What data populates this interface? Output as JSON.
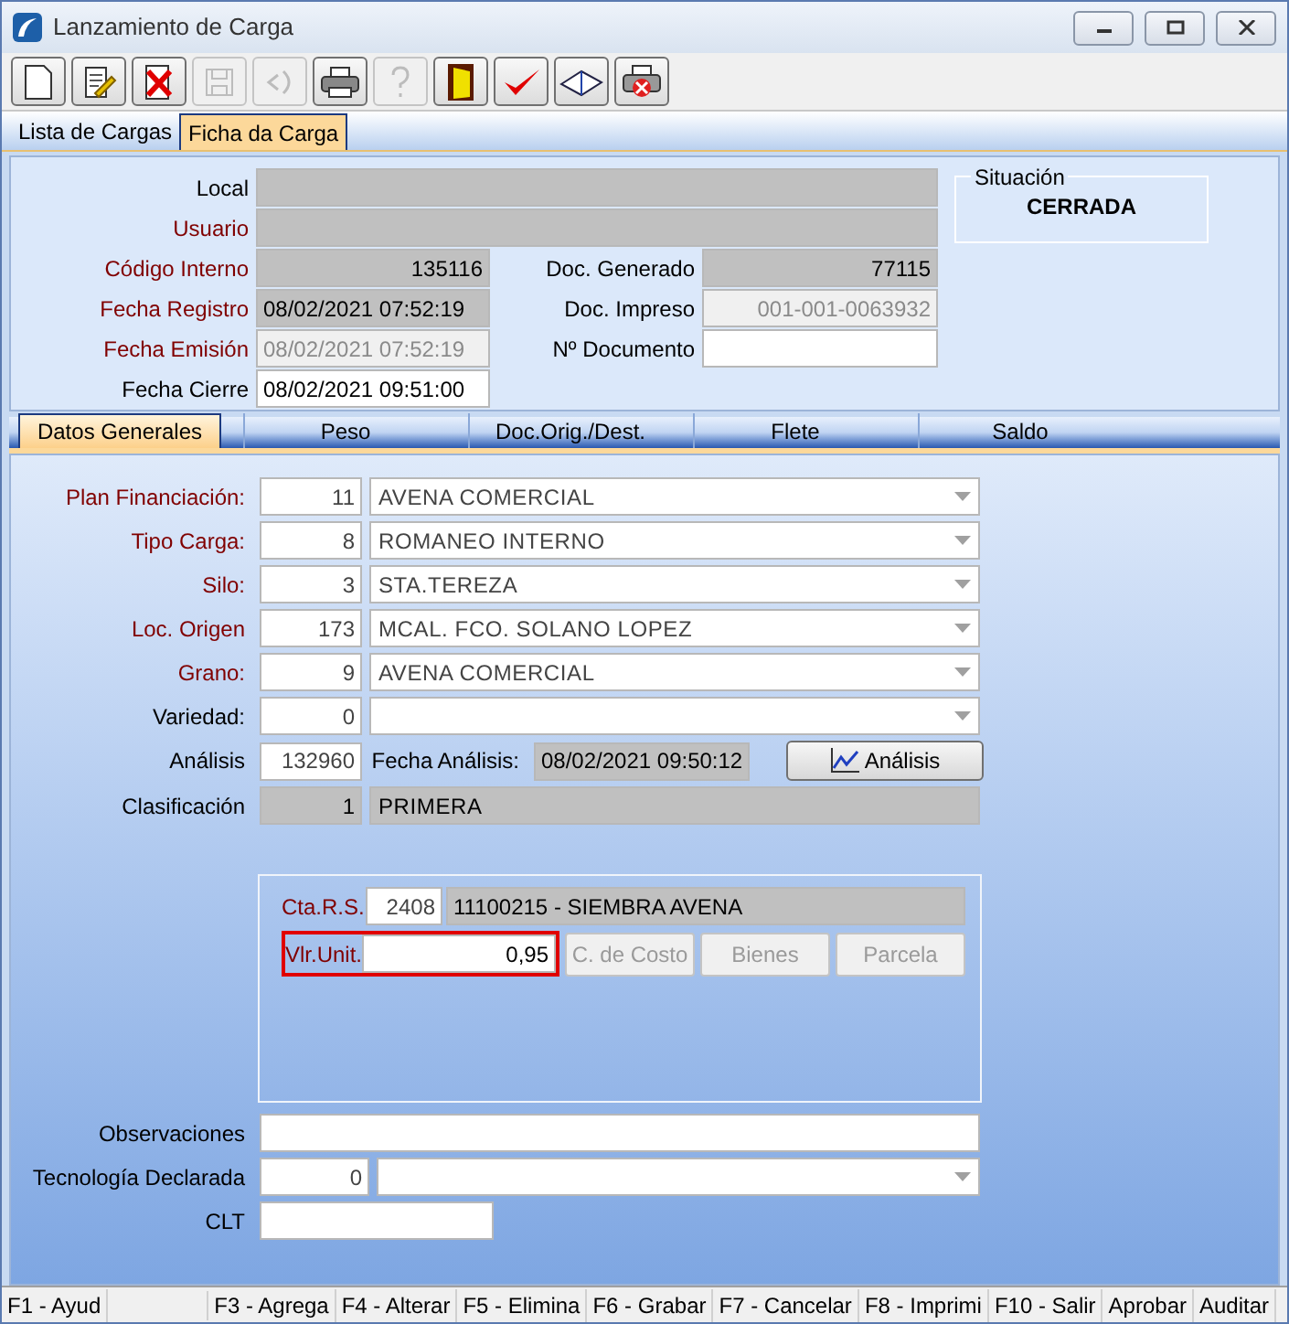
{
  "window": {
    "title": "Lanzamiento de Carga"
  },
  "toolbar": [
    {
      "disabled": false
    },
    {
      "disabled": false
    },
    {
      "disabled": false
    },
    {
      "disabled": true
    },
    {
      "disabled": true
    },
    {
      "disabled": false
    },
    {
      "disabled": true
    },
    {
      "disabled": false
    },
    {
      "disabled": false
    },
    {
      "disabled": false
    },
    {
      "disabled": false
    }
  ],
  "tabs": [
    {
      "label": "Lista de Cargas",
      "selected": false
    },
    {
      "label": "Ficha da Carga",
      "selected": true
    }
  ],
  "header": {
    "left": [
      {
        "label": "Local",
        "required": false,
        "kind": "wide"
      },
      {
        "label": "Usuario",
        "required": true,
        "kind": "wide"
      },
      {
        "label": "Código Interno",
        "required": true,
        "value": "135116",
        "kind": "readonly"
      },
      {
        "label": "Fecha Registro",
        "required": true,
        "value": "08/02/2021 07:52:19",
        "kind": "readonly"
      },
      {
        "label": "Fecha Emisión",
        "required": true,
        "value": "08/02/2021 07:52:19",
        "kind": "disabled"
      },
      {
        "label": "Fecha Cierre",
        "required": false,
        "value": "08/02/2021 09:51:00",
        "kind": "input"
      }
    ],
    "right": [
      {
        "label": "Doc. Generado",
        "value": "77115",
        "kind": "readonly"
      },
      {
        "label": "Doc. Impreso",
        "value": "001-001-0063932",
        "kind": "disabled"
      },
      {
        "label": "Nº Documento",
        "kind": "input"
      }
    ],
    "situacion": {
      "label": "Situación",
      "value": "CERRADA"
    }
  },
  "subtabs": [
    {
      "label": "Datos Generales",
      "selected": true
    },
    {
      "label": "Peso",
      "selected": false
    },
    {
      "label": "Doc.Orig./Dest.",
      "selected": false
    },
    {
      "label": "Flete",
      "selected": false
    },
    {
      "label": "Saldo",
      "selected": false
    }
  ],
  "fields": [
    {
      "label": "Plan Financiación:",
      "required": true,
      "code": "11",
      "value": "AVENA COMERCIAL"
    },
    {
      "label": "Tipo Carga:",
      "required": true,
      "code": "8",
      "value": "ROMANEO INTERNO"
    },
    {
      "label": "Silo:",
      "required": true,
      "code": "3",
      "value": "STA.TEREZA"
    },
    {
      "label": "Loc. Origen",
      "required": true,
      "code": "173",
      "value": "MCAL. FCO. SOLANO LOPEZ"
    },
    {
      "label": "Grano:",
      "required": true,
      "code": "9",
      "value": "AVENA COMERCIAL"
    },
    {
      "label": "Variedad:",
      "required": false,
      "code": "0"
    }
  ],
  "analisis": {
    "label": "Análisis",
    "code": "132960",
    "date_label": "Fecha Análisis:",
    "date": "08/02/2021 09:50:12",
    "button": "Análisis"
  },
  "clasificacion": {
    "label": "Clasificación",
    "code": "1",
    "value": "PRIMERA"
  },
  "cuenta": {
    "label": "Cta.R.S.",
    "code": "2408",
    "value": "11100215 - SIEMBRA AVENA",
    "unit_label": "Vlr.Unit.",
    "unit_value": "0,95",
    "highlighted": true,
    "buttons": [
      {
        "label": "C. de Costo",
        "disabled": true
      },
      {
        "label": "Bienes",
        "disabled": true
      },
      {
        "label": "Parcela",
        "disabled": true
      }
    ]
  },
  "observaciones": {
    "label": "Observaciones"
  },
  "tecnologia": {
    "label": "Tecnología Declarada",
    "code": "0"
  },
  "clt": {
    "label": "CLT"
  },
  "status_bar": [
    "F1 - Ayud",
    "F3 - Agrega",
    "F4 - Alterar",
    "F5 - Elimina",
    "F6 - Grabar",
    "F7 - Cancelar",
    "F8 - Imprimi",
    "F10 - Salir",
    "Aprobar",
    "Auditar"
  ]
}
